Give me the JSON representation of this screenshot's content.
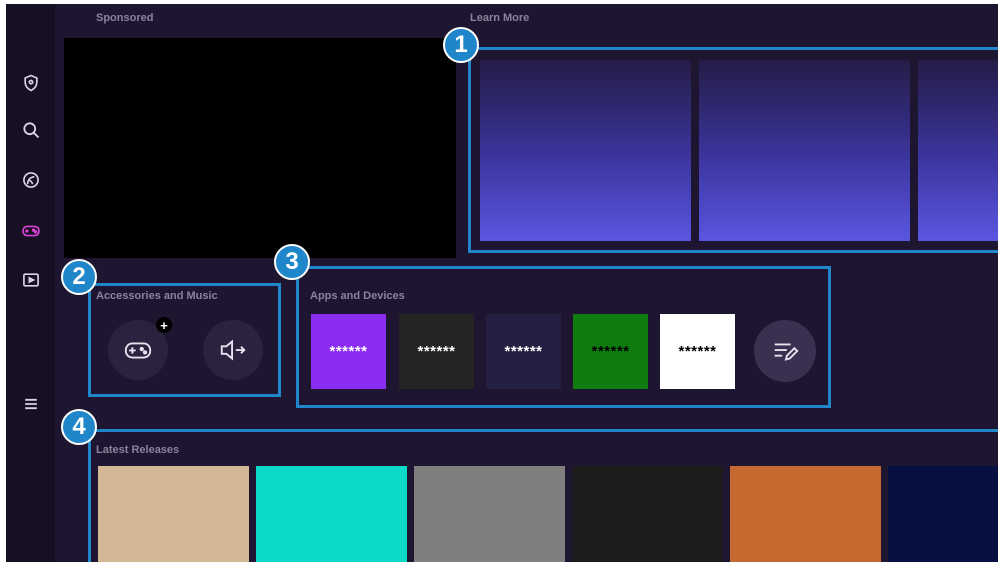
{
  "sidebar": {
    "items": [
      {
        "icon": "shield-icon"
      },
      {
        "icon": "search-icon"
      },
      {
        "icon": "ambient-icon"
      },
      {
        "icon": "gamepad-icon",
        "active": true
      },
      {
        "icon": "media-icon"
      },
      {
        "icon": "menu-icon"
      }
    ]
  },
  "sections": {
    "sponsored": "Sponsored",
    "learn_more": "Learn More",
    "accessories": "Accessories and Music",
    "apps": "Apps and Devices",
    "latest": "Latest Releases"
  },
  "callouts": [
    "1",
    "2",
    "3",
    "4"
  ],
  "accessories": {
    "add_badge": "+",
    "buttons": [
      {
        "icon": "gamepad-add-icon"
      },
      {
        "icon": "speaker-output-icon"
      }
    ]
  },
  "apps": [
    {
      "label": "******",
      "bg": "#8a2cf2",
      "fg": "#ffffff"
    },
    {
      "label": "******",
      "bg": "#242424",
      "fg": "#ffffff"
    },
    {
      "label": "******",
      "bg": "#242042",
      "fg": "#ffffff"
    },
    {
      "label": "******",
      "bg": "#107c10",
      "fg": "#000000"
    },
    {
      "label": "******",
      "bg": "#ffffff",
      "fg": "#000000"
    }
  ],
  "edit_button": {
    "icon": "edit-list-icon"
  },
  "latest_releases": [
    {
      "color": "#d4b896"
    },
    {
      "color": "#0cd8c8"
    },
    {
      "color": "#7f7f7f"
    },
    {
      "color": "#1c1c1c"
    },
    {
      "color": "#c46a30"
    },
    {
      "color": "#071040"
    }
  ],
  "colors": {
    "background": "#1e1630",
    "sidebar": "#170f24",
    "callout": "#1f86c9",
    "active_icon": "#d943d6"
  }
}
